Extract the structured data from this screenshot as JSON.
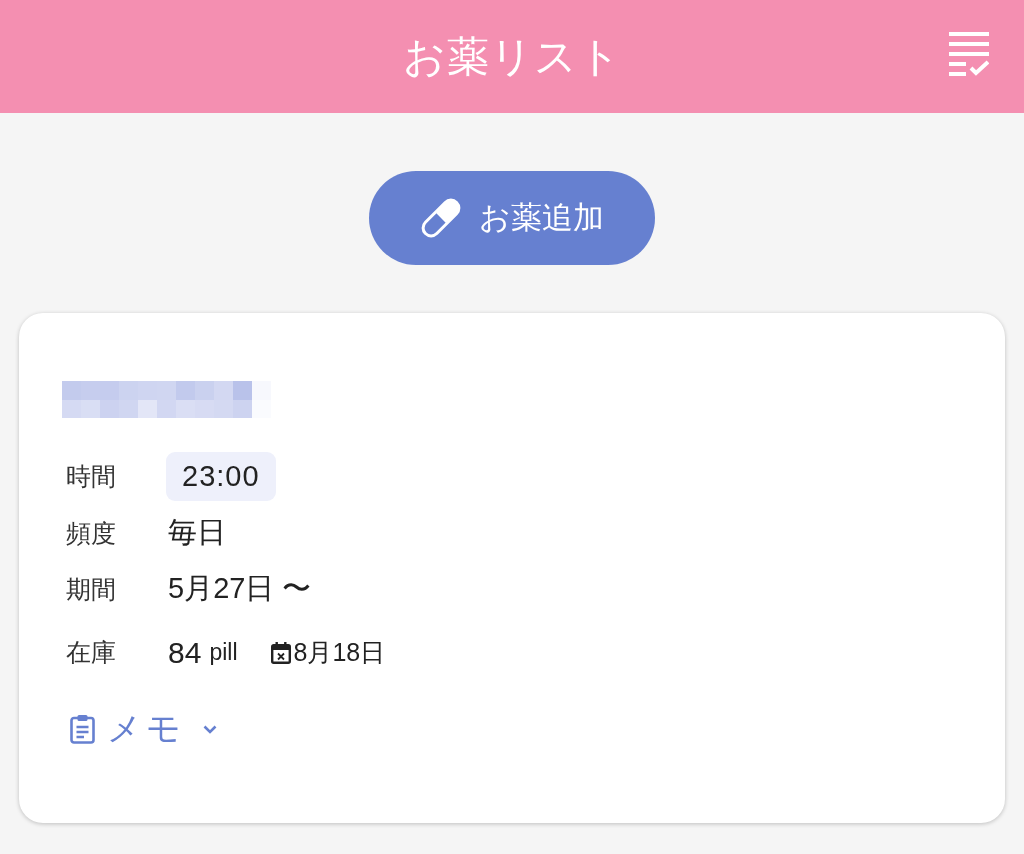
{
  "header": {
    "title": "お薬リスト"
  },
  "add_button": {
    "label": "お薬追加"
  },
  "medicine": {
    "details": [
      {
        "kind": "chip",
        "label": "時間",
        "value": "23:00"
      },
      {
        "kind": "text",
        "label": "頻度",
        "value": "毎日"
      },
      {
        "kind": "text",
        "label": "期間",
        "value": "5月27日 〜"
      },
      {
        "kind": "stock",
        "label": "在庫",
        "amount": "84",
        "unit": "pill",
        "end_date": "8月18日"
      }
    ],
    "memo": {
      "label": "メモ",
      "expanded": false
    }
  }
}
